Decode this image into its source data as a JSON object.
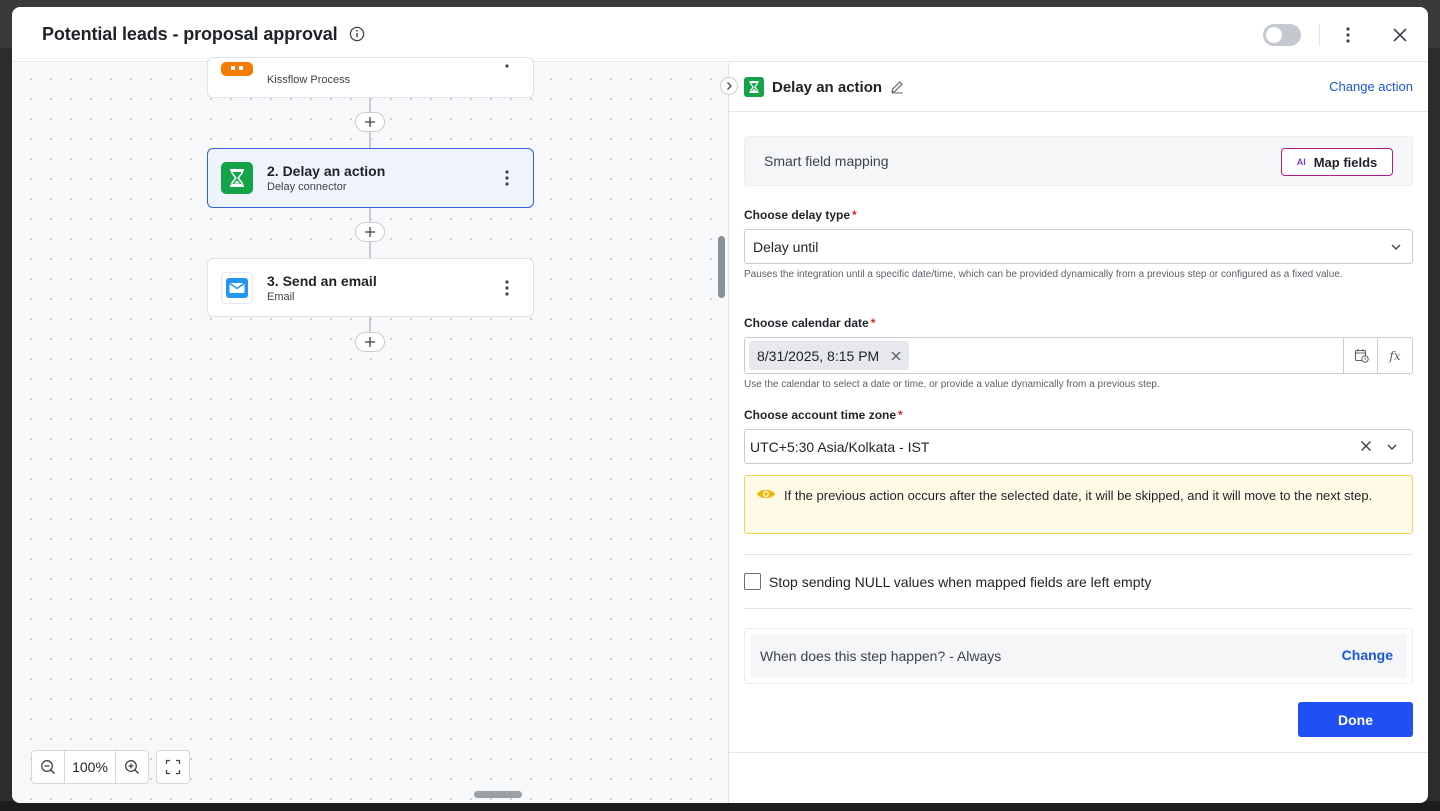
{
  "header": {
    "title": "Potential leads - proposal approval"
  },
  "flow": {
    "nodes": [
      {
        "title": "",
        "subtitle": "Kissflow Process"
      },
      {
        "title": "2. Delay an action",
        "subtitle": "Delay connector"
      },
      {
        "title": "3. Send an email",
        "subtitle": "Email"
      }
    ],
    "zoom_level": "100%"
  },
  "panel": {
    "title": "Delay an action",
    "change_action": "Change action",
    "smart_mapping": {
      "label": "Smart field mapping",
      "ai_badge": "AI",
      "button": "Map fields"
    },
    "delay_type": {
      "label": "Choose delay type",
      "value": "Delay until",
      "helper": "Pauses the integration until a specific date/time, which can be provided dynamically from a previous step or configured as a fixed value."
    },
    "calendar_date": {
      "label": "Choose calendar date",
      "value": "8/31/2025, 8:15 PM",
      "fx_label": "fx",
      "helper": "Use the calendar to select a date or time, or provide a value dynamically from a previous step."
    },
    "time_zone": {
      "label": "Choose account time zone",
      "value": "UTC+5:30 Asia/Kolkata - IST"
    },
    "alert": "If the previous action occurs after the selected date, it will be skipped, and it will move to the next step.",
    "null_checkbox": "Stop sending NULL values when mapped fields are left empty",
    "condition": {
      "text": "When does this step happen? - Always",
      "change": "Change"
    },
    "done": "Done"
  },
  "required_mark": "*",
  "colors": {
    "accent": "#1f4ff5",
    "link": "#1a56db",
    "delay_icon": "#15a34a",
    "email_icon": "#2196f3",
    "process_icon": "#f57c00",
    "alert_bg": "#fffbe6",
    "alert_border": "#f0d55c",
    "map_border": "#b71c8c"
  }
}
